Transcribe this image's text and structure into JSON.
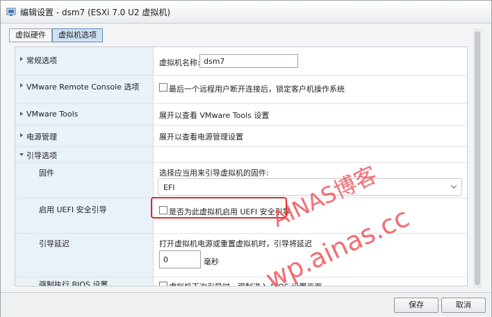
{
  "window": {
    "title": "编辑设置 - dsm7 (ESXi 7.0 U2 虚拟机)"
  },
  "tabs": [
    {
      "label": "虚拟硬件"
    },
    {
      "label": "虚拟机选项"
    }
  ],
  "rows": {
    "general": {
      "label": "常规选项",
      "field_label": "虚拟机名称:",
      "vm_name": "dsm7"
    },
    "vmrc": {
      "label": "VMware Remote Console 选项",
      "checkbox_text": "最后一个远程用户断开连接后，锁定客户机操作系统"
    },
    "tools": {
      "label": "VMware Tools",
      "text": "展开以查看 VMware Tools 设置"
    },
    "power": {
      "label": "电源管理",
      "text": "展开以查看电源管理设置"
    },
    "boot": {
      "label": "引导选项"
    },
    "firmware": {
      "label": "固件",
      "text": "选择应当用来引导虚拟机的固件:",
      "selected": "EFI"
    },
    "uefi": {
      "label": "启用 UEFI 安全引导",
      "checkbox_text": "是否为此虚拟机启用 UEFI 安全引导"
    },
    "boot_delay": {
      "label": "引导延迟",
      "text": "打开虚拟机电源或重置虚拟机时，引导将延迟",
      "value": "0",
      "unit": "毫秒"
    },
    "bios": {
      "label": "强制执行 BIOS 设置",
      "checkbox_text": "虚拟机下次引导时，强制进入 BIOS 设置画面"
    }
  },
  "footer": {
    "save_label": "保存",
    "cancel_label": "取消"
  },
  "watermark": {
    "line1": "AINAS博客",
    "line2": "wp.ainas.cc",
    "color": "#f2545a"
  },
  "colors": {
    "highlight": "#e0282a",
    "active_tab": "#cfe1f3",
    "left_cell": "#e9f1f9"
  }
}
